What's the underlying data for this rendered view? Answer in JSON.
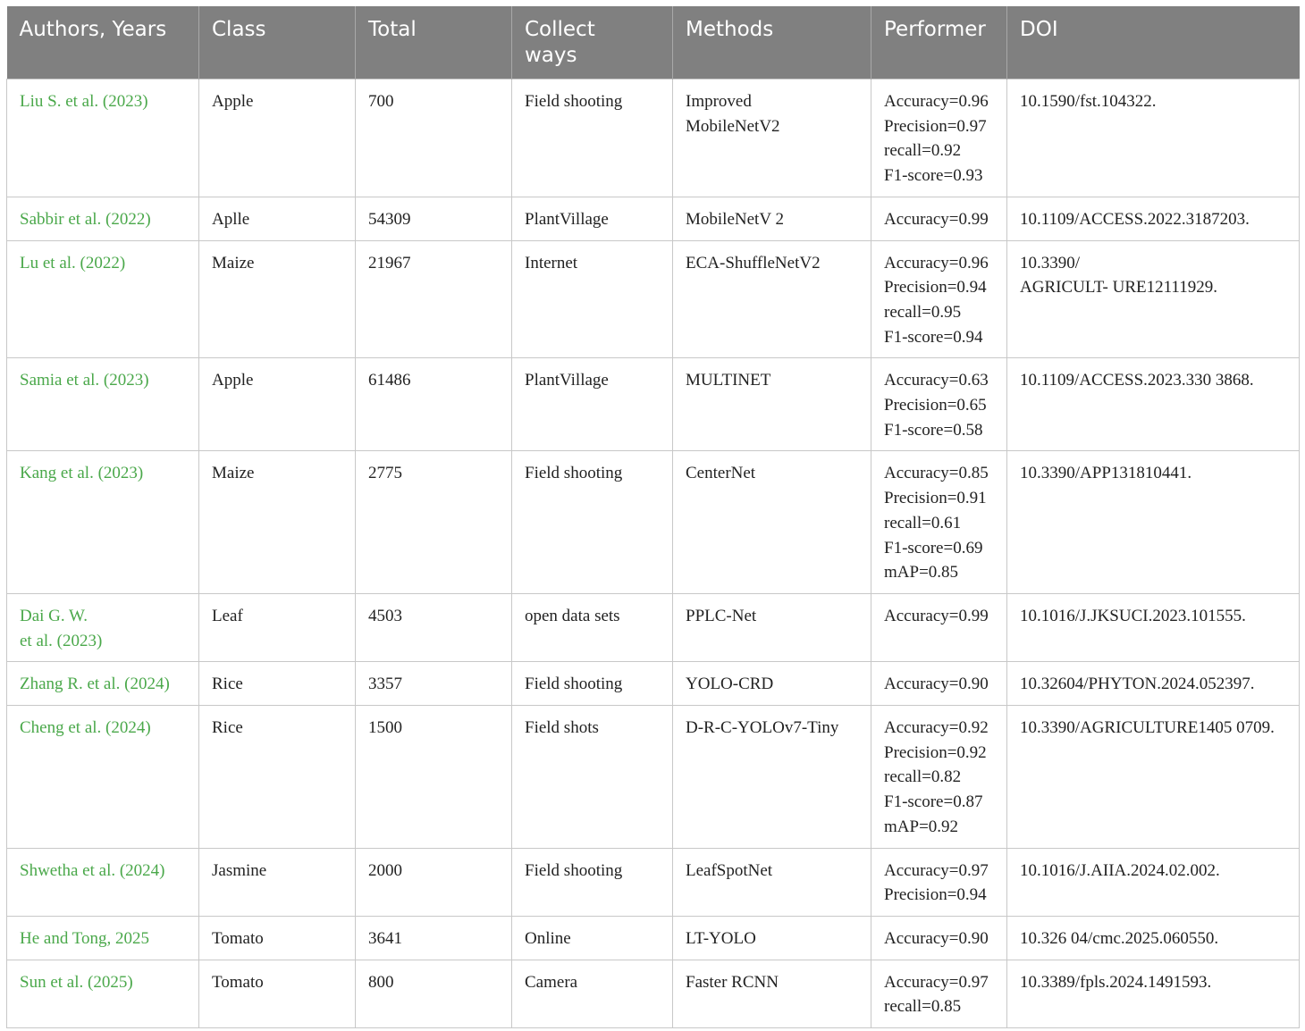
{
  "table": {
    "headers": [
      {
        "key": "authors",
        "label": "Authors, Years"
      },
      {
        "key": "class",
        "label": "Class"
      },
      {
        "key": "total",
        "label": "Total"
      },
      {
        "key": "collect",
        "label": "Collect ways"
      },
      {
        "key": "methods",
        "label": "Methods"
      },
      {
        "key": "performer",
        "label": "Performer"
      },
      {
        "key": "doi",
        "label": "DOI"
      }
    ],
    "rows": [
      {
        "authors": [
          "Liu S. et al. (2023)"
        ],
        "class": "Apple",
        "total": "700",
        "collect": "Field shooting",
        "methods": [
          "Improved",
          "MobileNetV2"
        ],
        "performer": [
          "Accuracy=0.96",
          "Precision=0.97",
          "recall=0.92",
          "F1-score=0.93"
        ],
        "doi": [
          "10.1590/fst.104322."
        ]
      },
      {
        "authors": [
          "Sabbir et al. (2022)"
        ],
        "class": "Aplle",
        "total": "54309",
        "collect": "PlantVillage",
        "methods": [
          "MobileNetV 2"
        ],
        "performer": [
          "Accuracy=0.99"
        ],
        "doi": [
          "10.1109/ACCESS.2022.3187203."
        ]
      },
      {
        "authors": [
          "Lu et al. (2022)"
        ],
        "class": "Maize",
        "total": "21967",
        "collect": "Internet",
        "methods": [
          "ECA-ShuffleNetV2"
        ],
        "performer": [
          "Accuracy=0.96",
          "Precision=0.94",
          "recall=0.95",
          "F1-score=0.94"
        ],
        "doi": [
          "10.3390/",
          "AGRICULT- URE12111929."
        ]
      },
      {
        "authors": [
          "Samia et al. (2023)"
        ],
        "class": "Apple",
        "total": "61486",
        "collect": "PlantVillage",
        "methods": [
          "MULTINET"
        ],
        "performer": [
          "Accuracy=0.63",
          "Precision=0.65",
          "F1-score=0.58"
        ],
        "doi": [
          "10.1109/ACCESS.2023.330 3868."
        ]
      },
      {
        "authors": [
          "Kang et al. (2023)"
        ],
        "class": "Maize",
        "total": "2775",
        "collect": "Field shooting",
        "methods": [
          "CenterNet"
        ],
        "performer": [
          "Accuracy=0.85",
          "Precision=0.91",
          "recall=0.61",
          "F1-score=0.69",
          "mAP=0.85"
        ],
        "doi": [
          "10.3390/APP131810441."
        ]
      },
      {
        "authors": [
          "Dai G. W.",
          "et al. (2023)"
        ],
        "class": "Leaf",
        "total": "4503",
        "collect": "open data sets",
        "methods": [
          "PPLC-Net"
        ],
        "performer": [
          "Accuracy=0.99"
        ],
        "doi": [
          "10.1016/J.JKSUCI.2023.101555."
        ]
      },
      {
        "authors": [
          "Zhang R. et al. (2024)"
        ],
        "class": "Rice",
        "total": "3357",
        "collect": "Field shooting",
        "methods": [
          "YOLO-CRD"
        ],
        "performer": [
          "Accuracy=0.90"
        ],
        "doi": [
          "10.32604/PHYTON.2024.052397."
        ]
      },
      {
        "authors": [
          "Cheng et al. (2024)"
        ],
        "class": "Rice",
        "total": "1500",
        "collect": "Field shots",
        "methods": [
          "D-R-C-YOLOv7-Tiny"
        ],
        "performer": [
          "Accuracy=0.92",
          "Precision=0.92",
          "recall=0.82",
          "F1-score=0.87",
          "mAP=0.92"
        ],
        "doi": [
          "10.3390/AGRICULTURE1405 0709."
        ]
      },
      {
        "authors": [
          "Shwetha et al. (2024)"
        ],
        "class": "Jasmine",
        "total": "2000",
        "collect": "Field shooting",
        "methods": [
          "LeafSpotNet"
        ],
        "performer": [
          "Accuracy=0.97",
          "Precision=0.94"
        ],
        "doi": [
          "10.1016/J.AIIA.2024.02.002."
        ]
      },
      {
        "authors": [
          "He and Tong, 2025"
        ],
        "class": "Tomato",
        "total": "3641",
        "collect": "Online",
        "methods": [
          "LT-YOLO"
        ],
        "performer": [
          "Accuracy=0.90"
        ],
        "doi": [
          "10.326 04/cmc.2025.060550."
        ]
      },
      {
        "authors": [
          "Sun et al. (2025)"
        ],
        "class": "Tomato",
        "total": "800",
        "collect": "Camera",
        "methods": [
          "Faster RCNN"
        ],
        "performer": [
          "Accuracy=0.97",
          "recall=0.85"
        ],
        "doi": [
          "10.3389/fpls.2024.1491593."
        ]
      }
    ]
  },
  "colors": {
    "header_bg": "#808080",
    "header_text": "#ffffff",
    "author_link": "#4aa84a",
    "body_text": "#222222",
    "grid": "#c8c8c8"
  }
}
